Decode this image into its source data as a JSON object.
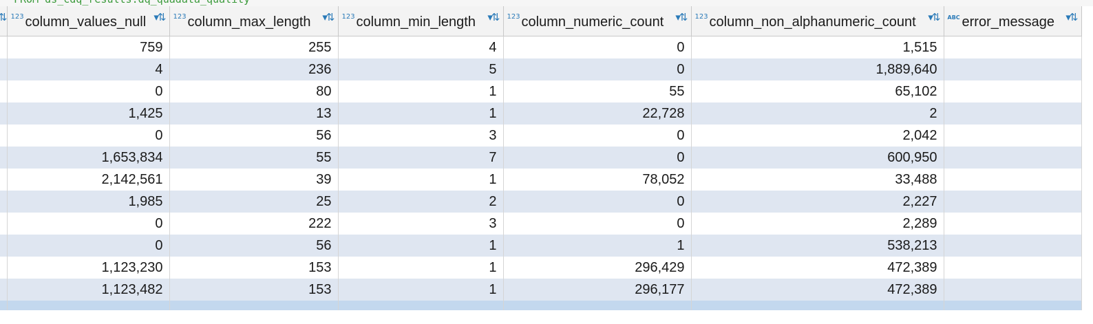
{
  "sql_fragment": "FROM ds_cdq_results.dq_quadata_quality",
  "columns": [
    {
      "name": "column_values_null",
      "type_icon": "123"
    },
    {
      "name": "column_max_length",
      "type_icon": "123"
    },
    {
      "name": "column_min_length",
      "type_icon": "123"
    },
    {
      "name": "column_numeric_count",
      "type_icon": "123"
    },
    {
      "name": "column_non_alphanumeric_count",
      "type_icon": "123"
    },
    {
      "name": "error_message",
      "type_icon": "ABC"
    }
  ],
  "sort_icon": "sort-filter-icon",
  "rows": [
    [
      "759",
      "255",
      "4",
      "0",
      "1,515",
      ""
    ],
    [
      "4",
      "236",
      "5",
      "0",
      "1,889,640",
      ""
    ],
    [
      "0",
      "80",
      "1",
      "55",
      "65,102",
      ""
    ],
    [
      "1,425",
      "13",
      "1",
      "22,728",
      "2",
      ""
    ],
    [
      "0",
      "56",
      "3",
      "0",
      "2,042",
      ""
    ],
    [
      "1,653,834",
      "55",
      "7",
      "0",
      "600,950",
      ""
    ],
    [
      "2,142,561",
      "39",
      "1",
      "78,052",
      "33,488",
      ""
    ],
    [
      "1,985",
      "25",
      "2",
      "0",
      "2,227",
      ""
    ],
    [
      "0",
      "222",
      "3",
      "0",
      "2,289",
      ""
    ],
    [
      "0",
      "56",
      "1",
      "1",
      "538,213",
      ""
    ],
    [
      "1,123,230",
      "153",
      "1",
      "296,429",
      "472,389",
      ""
    ],
    [
      "1,123,482",
      "153",
      "1",
      "296,177",
      "472,389",
      ""
    ]
  ],
  "colors": {
    "row_alt": "#dfe6f1",
    "row_selected": "#c3d8ee",
    "type_icon": "#2a7ab8",
    "header_bg": "#f3f3f3"
  }
}
